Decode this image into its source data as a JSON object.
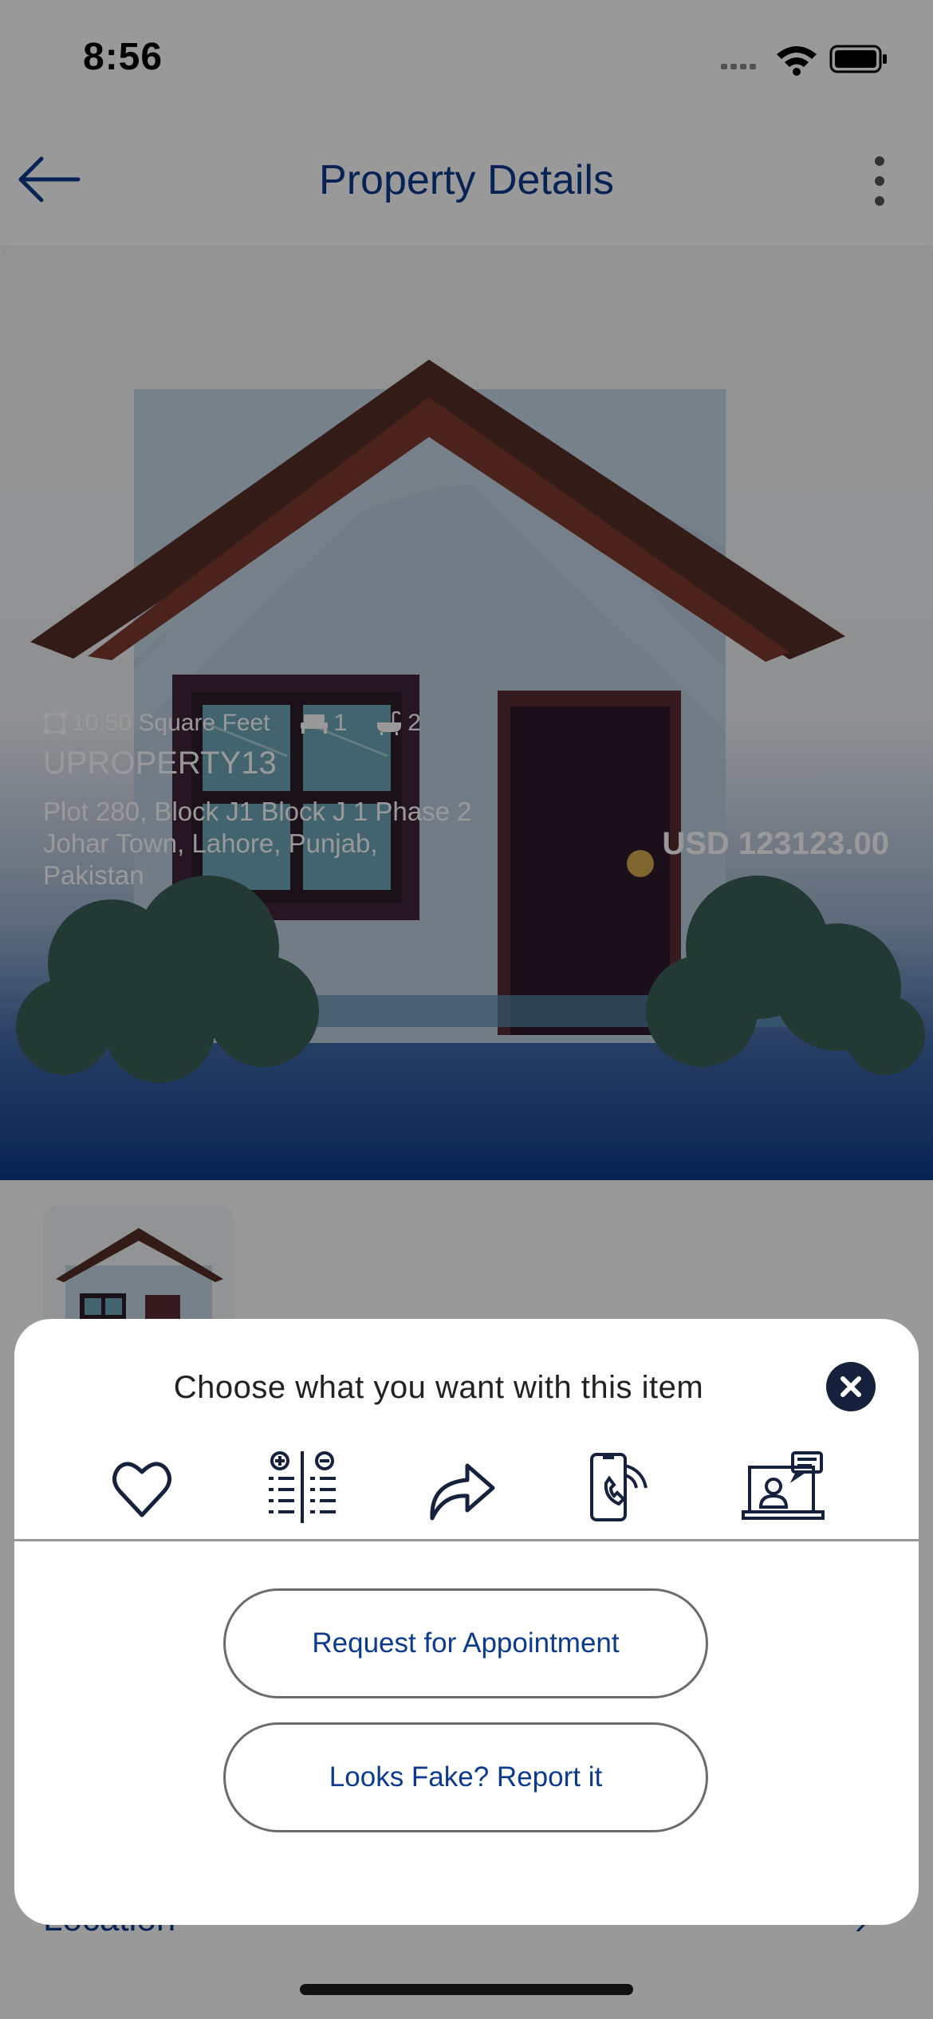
{
  "status_bar": {
    "time": "8:56"
  },
  "nav": {
    "title": "Property Details"
  },
  "property": {
    "area": "10.50 Square Feet",
    "beds": "1",
    "baths": "2",
    "name": "UPROPERTY13",
    "address": "Plot 280, Block J1 Block J 1 Phase 2 Johar Town, Lahore, Punjab, Pakistan",
    "price": "USD 123123.00"
  },
  "details": {
    "location_label": "Location",
    "location_chevron": "›"
  },
  "sheet": {
    "title": "Choose what you want with this item",
    "actions": [
      "favorite-icon",
      "compare-icon",
      "share-icon",
      "call-icon",
      "virtual-tour-icon"
    ],
    "request_appointment": "Request for Appointment",
    "report_fake": "Looks Fake? Report it"
  },
  "colors": {
    "brand_blue": "#0c3a8c",
    "close_button": "#15213d",
    "overlay": "rgba(0,0,0,0.40)"
  }
}
